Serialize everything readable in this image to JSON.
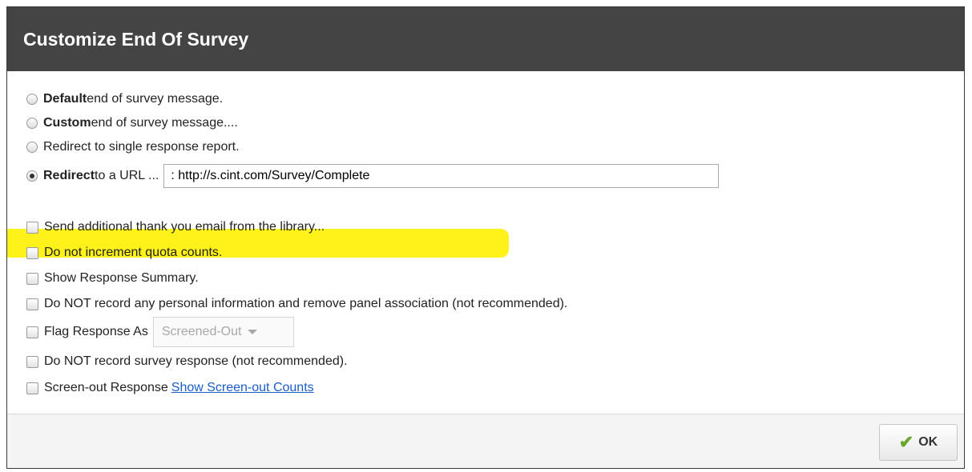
{
  "dialog": {
    "title": "Customize End Of Survey"
  },
  "radios": [
    {
      "bold": "Default",
      "text": " end of survey message.",
      "checked": false
    },
    {
      "bold": "Custom",
      "text": " end of survey message....",
      "checked": false
    },
    {
      "bold": "",
      "text": "Redirect to single response report.",
      "checked": false
    },
    {
      "bold": "Redirect",
      "text": " to a URL ...",
      "checked": true
    }
  ],
  "redirect_url": {
    "value": ": http://s.cint.com/Survey/Complete"
  },
  "checkboxes": [
    {
      "label": "Send additional thank you email from the library...",
      "checked": false
    },
    {
      "label": "Do not increment quota counts.",
      "checked": false
    },
    {
      "label": "Show Response Summary.",
      "checked": false
    },
    {
      "label": "Do NOT record any personal information and remove panel association (not recommended).",
      "checked": false
    },
    {
      "label": "Flag Response As",
      "checked": false,
      "select_value": "Screened-Out"
    },
    {
      "label": "Do NOT record survey response (not recommended).",
      "checked": false
    },
    {
      "label": "Screen-out Response",
      "checked": false,
      "link": "Show Screen-out Counts"
    }
  ],
  "footer": {
    "ok_label": "OK",
    "ok_icon": "checkmark-icon"
  },
  "colors": {
    "titlebar": "#444444",
    "highlight": "#fff21a",
    "link": "#1a5cc8",
    "check_icon": "#6aa629"
  }
}
